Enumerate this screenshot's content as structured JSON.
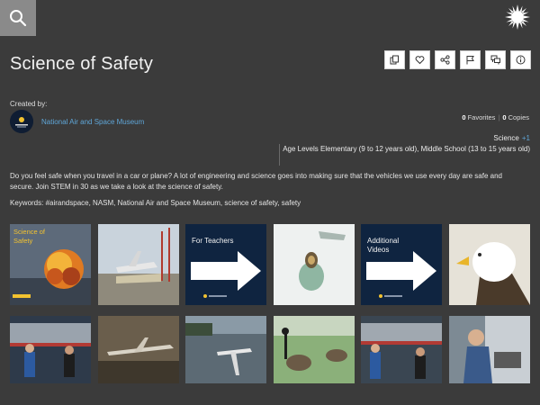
{
  "page": {
    "title": "Science of Safety"
  },
  "created": {
    "label": "Created by:",
    "name": "National Air and Space Museum"
  },
  "stats": {
    "favorites_count": "0",
    "favorites_label": "Favorites",
    "copies_count": "0",
    "copies_label": "Copies"
  },
  "meta": {
    "subject": "Science",
    "subject_more": "+1",
    "age_levels": "Age Levels Elementary (9 to 12 years old), Middle School (13 to 15 years old)"
  },
  "description": "Do you feel safe when you travel in a car or plane? A lot of engineering and science goes into making sure that the vehicles we use every day are safe and secure. Join STEM in 30 as we take a look at the science of safety.",
  "keywords": "Keywords: #airandspace, NASM, National Air and Space Museum, science of safety, safety",
  "thumbnails": [
    {
      "label": "Science of Safety"
    },
    {
      "label": ""
    },
    {
      "label": "For Teachers"
    },
    {
      "label": ""
    },
    {
      "label": "Additional Videos"
    },
    {
      "label": ""
    }
  ],
  "icons": [
    "search-icon",
    "sun-logo-icon",
    "copy-icon",
    "heart-icon",
    "share-icon",
    "flag-icon",
    "comment-icon",
    "info-icon"
  ],
  "colors": {
    "accent": "#5fa6d8",
    "background": "#3b3b3b",
    "search_bg": "#8a8a8a",
    "navy": "#0f2440"
  }
}
